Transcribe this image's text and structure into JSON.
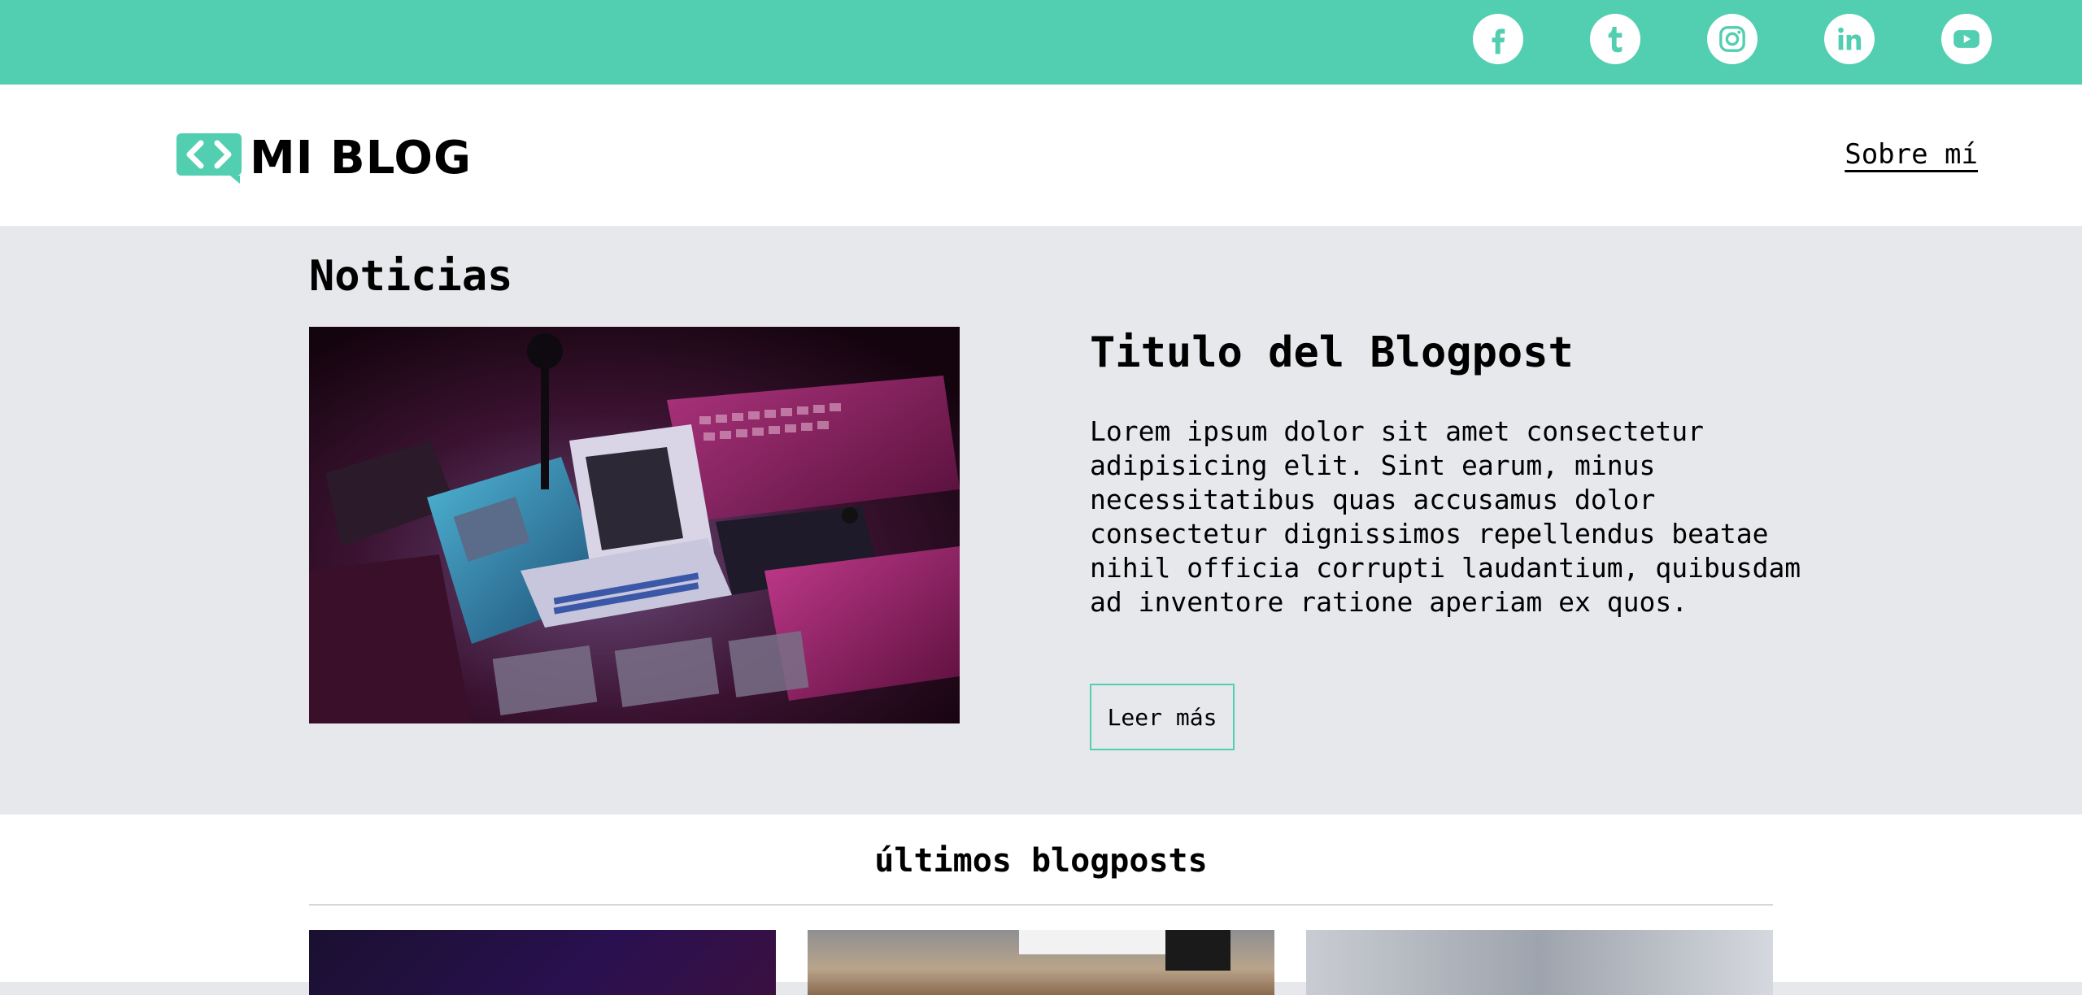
{
  "social": {
    "items": [
      {
        "name": "facebook-icon",
        "label": "Facebook"
      },
      {
        "name": "tumblr-icon",
        "label": "Tumblr"
      },
      {
        "name": "instagram-icon",
        "label": "Instagram"
      },
      {
        "name": "linkedin-icon",
        "label": "LinkedIn"
      },
      {
        "name": "youtube-icon",
        "label": "YouTube"
      }
    ],
    "bg_color": "#52ceb0"
  },
  "header": {
    "logo_text": "MI BLOG",
    "nav_link": "Sobre mí"
  },
  "news": {
    "section_title": "Noticias",
    "post_title": "Titulo del Blogpost",
    "post_body": "Lorem ipsum dolor sit amet consectetur adipisicing elit. Sint earum, minus necessitatibus quas accusamus dolor consectetur dignissimos repellendus beatae nihil officia corrupti laudantium, quibusdam ad inventore ratione aperiam ex quos.",
    "read_more": "Leer más"
  },
  "latest": {
    "section_title": "últimos blogposts"
  },
  "colors": {
    "accent": "#52ceb0",
    "news_bg": "#e7e8ec"
  }
}
